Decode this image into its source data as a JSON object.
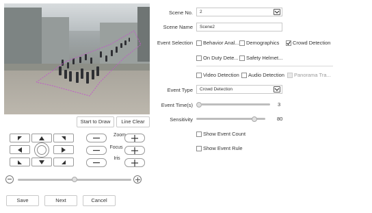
{
  "ptz": {
    "zoom_label": "Zoom",
    "focus_label": "Focus",
    "iris_label": "Iris",
    "speed_slider_value": 0.5
  },
  "video": {
    "start_draw_label": "Start to Draw",
    "line_clear_label": "Line Clear"
  },
  "form": {
    "scene_no_label": "Scene No.",
    "scene_no_value": "2",
    "scene_name_label": "Scene Name",
    "scene_name_value": "Scene2",
    "event_selection_label": "Event Selection",
    "events_row1": [
      {
        "label": "Behavior Anal...",
        "checked": false
      },
      {
        "label": "Demographics",
        "checked": false
      },
      {
        "label": "Crowd Detection",
        "checked": true
      }
    ],
    "events_row2": [
      {
        "label": "On Duty Dete...",
        "checked": false
      },
      {
        "label": "Safety Helmet...",
        "checked": false
      }
    ],
    "events_row3": [
      {
        "label": "Video Detection",
        "checked": false
      },
      {
        "label": "Audio Detection",
        "checked": false
      },
      {
        "label": "Panorama Tra...",
        "checked": false,
        "disabled": true
      }
    ],
    "event_type_label": "Event Type",
    "event_type_value": "Crowd Detection",
    "event_time_label": "Event Time(s)",
    "event_time_value": "3",
    "sensitivity_label": "Sensitivity",
    "sensitivity_value": "80",
    "show_event_count_label": "Show Event Count",
    "show_event_rule_label": "Show Event Rule"
  },
  "footer": {
    "save_label": "Save",
    "next_label": "Next",
    "cancel_label": "Cancel"
  },
  "colors": {
    "region_line": "#c05ac8",
    "border": "#c9c9c9",
    "icon": "#333333"
  }
}
